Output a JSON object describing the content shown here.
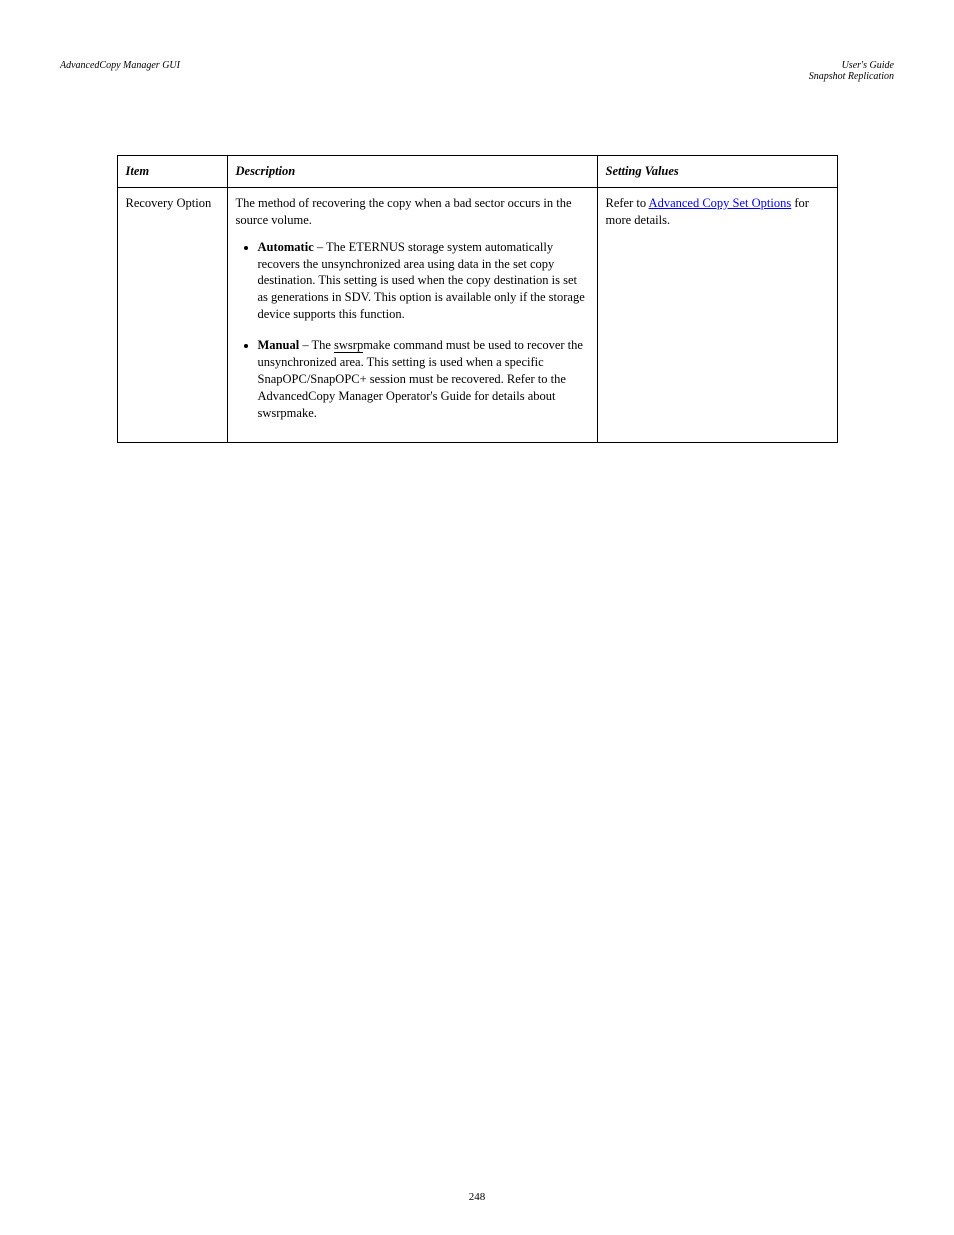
{
  "header": {
    "left_title": "AdvancedCopy Manager GUI",
    "left_sub": "",
    "right_title": "User's Guide",
    "right_sub": "Snapshot Replication"
  },
  "table": {
    "headers": [
      "Item",
      "Description",
      "Setting Values"
    ],
    "row": {
      "item": "Recovery Option",
      "desc_intro": "The method of recovering the copy when a bad sector occurs in the source volume.",
      "bullets": [
        {
          "lead_bold": "Automatic",
          "lead_rest": " – ",
          "body": "The ETERNUS storage system automatically recovers the unsynchronized area using data in the set copy destination. This setting is used when the copy destination is set as generations in SDV. This option is available only if the storage device supports this function."
        },
        {
          "lead_bold": "Manual",
          "lead_rest": " – The ",
          "underline_word": "swsrp",
          "after_underline": "make command must be used to recover the unsynchronized area. This setting is used when a specific SnapOPC/SnapOPC+ session must be recovered. Refer to the AdvancedCopy Manager Operator's Guide for details about swsrpmake."
        }
      ],
      "setting_prefix": "Refer to ",
      "link_text": "Advanced Copy Set Options",
      "setting_rest": " for more details."
    }
  },
  "footer": "248"
}
